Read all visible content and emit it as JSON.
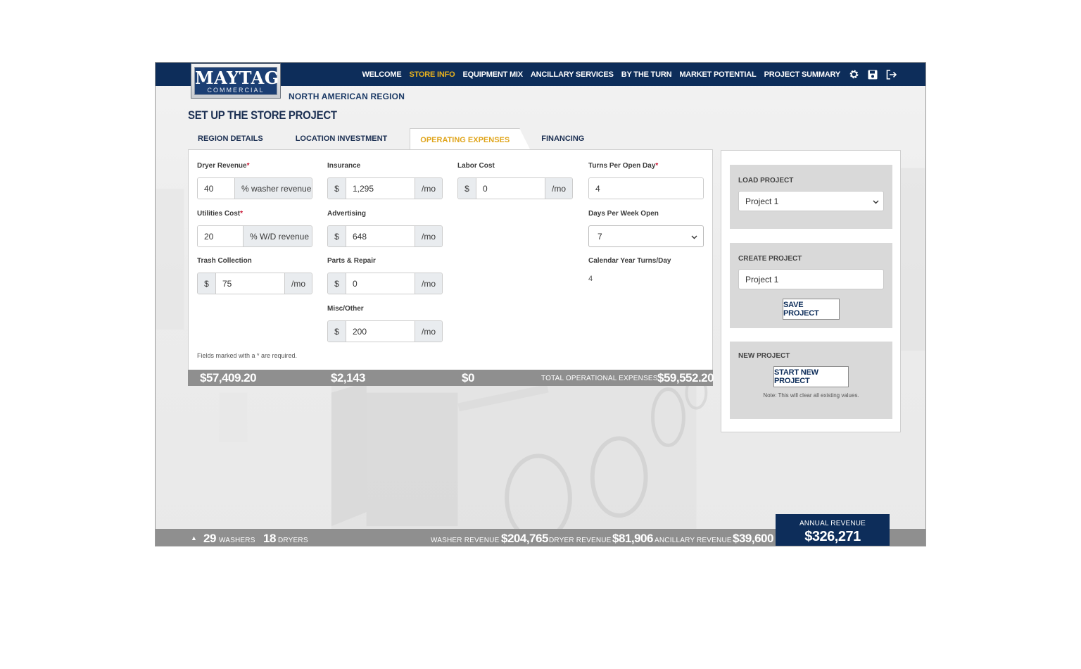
{
  "brand": {
    "logo_main": "MAYTAG",
    "logo_sub": "COMMERCIAL",
    "region": "NORTH AMERICAN REGION"
  },
  "nav": {
    "items": [
      "WELCOME",
      "STORE INFO",
      "EQUIPMENT MIX",
      "ANCILLARY SERVICES",
      "BY THE TURN",
      "MARKET POTENTIAL",
      "PROJECT SUMMARY"
    ],
    "active_index": 1,
    "icons": [
      "gear-icon",
      "save-icon",
      "logout-icon"
    ]
  },
  "page_title": "SET UP THE STORE PROJECT",
  "tabs": [
    "REGION DETAILS",
    "LOCATION INVESTMENT",
    "OPERATING EXPENSES",
    "FINANCING"
  ],
  "active_tab": "OPERATING EXPENSES",
  "form": {
    "dryer_revenue": {
      "label": "Dryer Revenue",
      "required": "*",
      "value": "40",
      "suffix": "% washer revenue"
    },
    "utilities_cost": {
      "label": "Utilities Cost",
      "required": "*",
      "value": "20",
      "suffix": "% W/D revenue"
    },
    "trash_collection": {
      "label": "Trash Collection",
      "prefix": "$",
      "value": "75",
      "suffix": "/mo"
    },
    "insurance": {
      "label": "Insurance",
      "prefix": "$",
      "value": "1,295",
      "suffix": "/mo"
    },
    "advertising": {
      "label": "Advertising",
      "prefix": "$",
      "value": "648",
      "suffix": "/mo"
    },
    "parts_repair": {
      "label": "Parts & Repair",
      "prefix": "$",
      "value": "0",
      "suffix": "/mo"
    },
    "misc_other": {
      "label": "Misc/Other",
      "prefix": "$",
      "value": "200",
      "suffix": "/mo"
    },
    "labor_cost": {
      "label": "Labor Cost",
      "prefix": "$",
      "value": "0",
      "suffix": "/mo"
    },
    "turns_per_day": {
      "label": "Turns Per Open Day",
      "required": "*",
      "value": "4"
    },
    "days_per_week": {
      "label": "Days Per Week Open",
      "value": "7"
    },
    "calendar_turns": {
      "label": "Calendar Year Turns/Day",
      "value": "4"
    },
    "note": "Fields marked with a * are required."
  },
  "totals": {
    "col1": "$57,409.20",
    "col2": "$2,143",
    "col3": "$0",
    "total_label": "TOTAL OPERATIONAL EXPENSES",
    "total_value": "$59,552.20"
  },
  "sidebar": {
    "load": {
      "title": "LOAD PROJECT",
      "selected": "Project 1"
    },
    "create": {
      "title": "CREATE PROJECT",
      "value": "Project 1",
      "button": "SAVE PROJECT"
    },
    "new": {
      "title": "NEW PROJECT",
      "button": "START NEW PROJECT",
      "note": "Note: This will clear all existing values."
    }
  },
  "bottom": {
    "caret": "▲",
    "washers_count": "29",
    "washers_label": "WASHERS",
    "dryers_count": "18",
    "dryers_label": "DRYERS",
    "washer_rev_label": "WASHER REVENUE",
    "washer_rev": "$204,765",
    "dryer_rev_label": "DRYER REVENUE",
    "dryer_rev": "$81,906",
    "ancillary_rev_label": "ANCILLARY REVENUE",
    "ancillary_rev": "$39,600",
    "annual_label": "ANNUAL REVENUE",
    "annual_value": "$326,271"
  },
  "colors": {
    "navy": "#0d2d5a",
    "gold": "#e0a51c",
    "gray_bar": "#8f8f8f",
    "required": "#c8102e"
  }
}
